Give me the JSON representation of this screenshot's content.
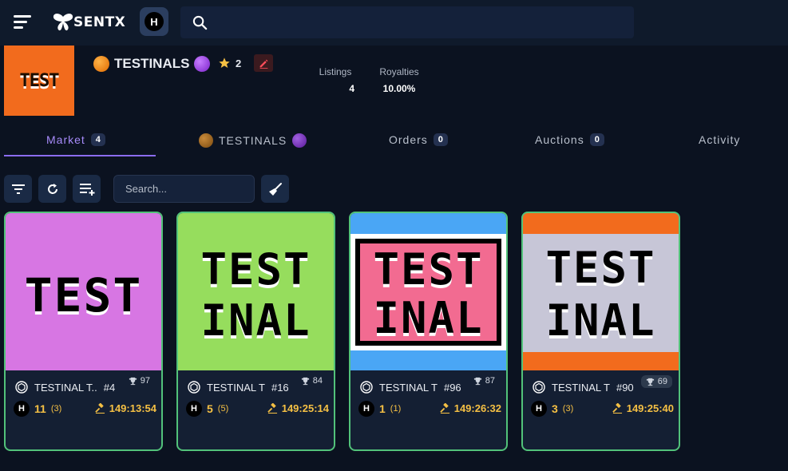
{
  "app": {
    "logo_text": "SENTX",
    "network_letter": "H"
  },
  "collection": {
    "logo_text": "TEST",
    "name": "TESTINALS",
    "stars": "2",
    "stats": [
      {
        "label": "Listings",
        "value": "4"
      },
      {
        "label": "Royalties",
        "value": "10.00%"
      }
    ]
  },
  "tabs": [
    {
      "label": "Market",
      "badge": "4"
    },
    {
      "label": "TESTINALS",
      "badge": ""
    },
    {
      "label": "Orders",
      "badge": "0"
    },
    {
      "label": "Auctions",
      "badge": "0"
    },
    {
      "label": "Activity",
      "badge": ""
    }
  ],
  "filter": {
    "placeholder": "Search..."
  },
  "colors": {
    "accent": "#8b6cf0",
    "card_border": "#52c27a",
    "price": "#f5c044"
  },
  "cards": [
    {
      "art_line1": "TEST",
      "art_line2": "",
      "name": "TESTINAL  T..",
      "number": "#4",
      "rank": "97",
      "price": "11",
      "count": "(3)",
      "timer": "149:13:54",
      "bg": "#d776e3"
    },
    {
      "art_line1": "TEST",
      "art_line2": "INAL",
      "name": "TESTINAL  T",
      "number": "#16",
      "rank": "84",
      "price": "5",
      "count": "(5)",
      "timer": "149:25:14",
      "bg": "#96dd5d"
    },
    {
      "art_line1": "TEST",
      "art_line2": "INAL",
      "name": "TESTINAL  T",
      "number": "#96",
      "rank": "87",
      "price": "1",
      "count": "(1)",
      "timer": "149:26:32",
      "bg": "#f26b91"
    },
    {
      "art_line1": "TEST",
      "art_line2": "INAL",
      "name": "TESTINAL  T",
      "number": "#90",
      "rank": "69",
      "price": "3",
      "count": "(3)",
      "timer": "149:25:40",
      "bg": "#c7c6d7"
    }
  ]
}
